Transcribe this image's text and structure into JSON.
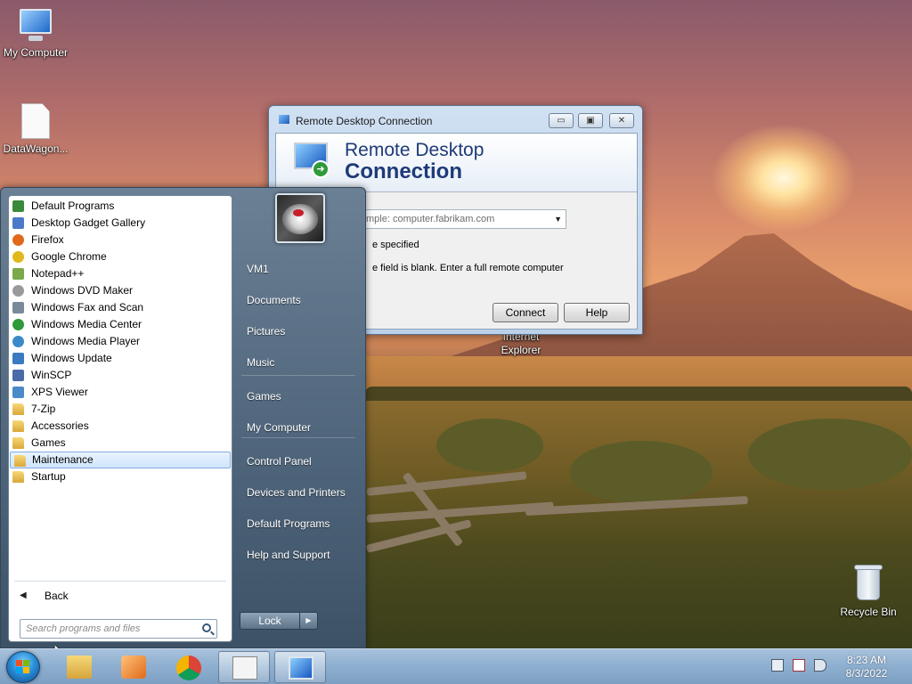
{
  "desktop": {
    "icons": [
      {
        "label": "My Computer",
        "icon": "computer-icon"
      },
      {
        "label": "DataWagon...",
        "icon": "file-shortcut-icon"
      },
      {
        "label": "Recycle Bin",
        "icon": "recycle-bin-icon"
      }
    ],
    "ie_label": "Internet\nExplorer"
  },
  "rdp_window": {
    "title": "Remote Desktop Connection",
    "heading_line1": "Remote Desktop",
    "heading_line2": "Connection",
    "computer_combo_text": "mple: computer.fabrikam.com",
    "info_text1": "e specified",
    "info_text2": "e field is blank. Enter a full remote computer",
    "connect_label": "Connect",
    "help_label": "Help",
    "min_glyph": "▭",
    "max_glyph": "▣",
    "close_glyph": "✕"
  },
  "start_menu": {
    "programs": [
      {
        "label": "Default Programs",
        "icon": "default-programs-icon",
        "color": "#3a8a3a"
      },
      {
        "label": "Desktop Gadget Gallery",
        "icon": "gadget-icon",
        "color": "#4a7ac8"
      },
      {
        "label": "Firefox",
        "icon": "firefox-icon",
        "color": "#e06a1a"
      },
      {
        "label": "Google Chrome",
        "icon": "chrome-icon",
        "color": "#e0b81a"
      },
      {
        "label": "Notepad++",
        "icon": "notepad-plus-icon",
        "color": "#7aa84a"
      },
      {
        "label": "Windows DVD Maker",
        "icon": "dvd-maker-icon",
        "color": "#9a9a9a"
      },
      {
        "label": "Windows Fax and Scan",
        "icon": "fax-scan-icon",
        "color": "#7a8a9a"
      },
      {
        "label": "Windows Media Center",
        "icon": "media-center-icon",
        "color": "#2e9a3a"
      },
      {
        "label": "Windows Media Player",
        "icon": "media-player-icon",
        "color": "#3a8ac8"
      },
      {
        "label": "Windows Update",
        "icon": "windows-update-icon",
        "color": "#3a7ac0"
      },
      {
        "label": "WinSCP",
        "icon": "winscp-icon",
        "color": "#4a6aa8"
      },
      {
        "label": "XPS Viewer",
        "icon": "xps-viewer-icon",
        "color": "#4a8ac8"
      },
      {
        "label": "7-Zip",
        "icon": "folder-icon",
        "color": "#e0b040"
      },
      {
        "label": "Accessories",
        "icon": "folder-icon",
        "color": "#e0b040"
      },
      {
        "label": "Games",
        "icon": "folder-icon",
        "color": "#e0b040"
      },
      {
        "label": "Maintenance",
        "icon": "folder-icon",
        "color": "#e0b040",
        "highlighted": true
      },
      {
        "label": "Startup",
        "icon": "folder-icon",
        "color": "#e0b040"
      }
    ],
    "back_label": "Back",
    "search_placeholder": "Search programs and files",
    "right_items": [
      "VM1",
      "Documents",
      "Pictures",
      "Music",
      "Games",
      "My Computer",
      "Control Panel",
      "Devices and Printers",
      "Default Programs",
      "Help and Support"
    ],
    "lock_label": "Lock",
    "lock_arrow": "▶"
  },
  "taskbar": {
    "time": "8:23 AM",
    "date": "8/3/2022",
    "pinned": [
      "explorer-icon",
      "media-player-icon",
      "chrome-icon",
      "file-shortcut-icon",
      "remote-desktop-icon"
    ]
  }
}
